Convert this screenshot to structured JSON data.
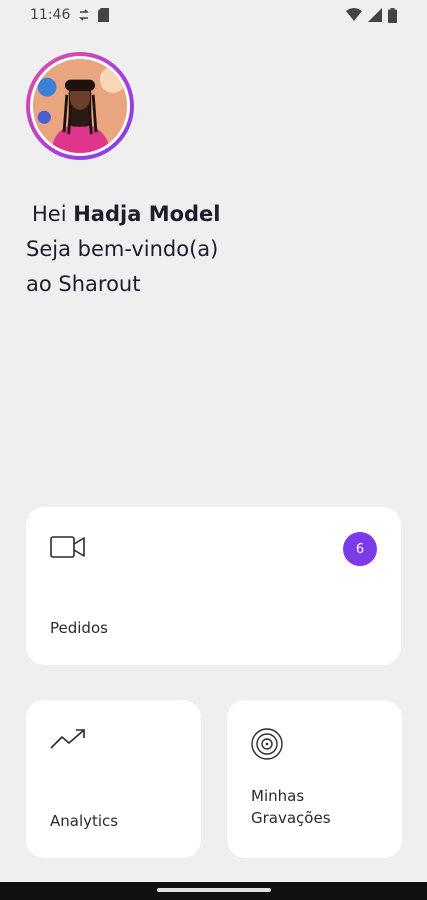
{
  "status_bar": {
    "time": "11:46",
    "icons": [
      "sync-icon",
      "sd-card-icon",
      "wifi-icon",
      "signal-icon",
      "battery-icon"
    ]
  },
  "profile": {
    "avatar_icon": "user-photo"
  },
  "greeting": {
    "prefix": "Hei",
    "name": "Hadja Model",
    "line2": "Seja bem-vindo(a)",
    "line3": "ao Sharout"
  },
  "cards": {
    "pedidos": {
      "label": "Pedidos",
      "icon": "video-camera-icon",
      "badge": "6"
    },
    "analytics": {
      "label": "Analytics",
      "icon": "trending-up-icon"
    },
    "gravacoes": {
      "label_line1": "Minhas",
      "label_line2": "Gravações",
      "icon": "target-icon"
    }
  },
  "colors": {
    "background": "#efefef",
    "card": "#ffffff",
    "accent": "#7d3ae8",
    "avatar_ring_start": "#e34fa0",
    "avatar_ring_end": "#7b3fe4"
  }
}
